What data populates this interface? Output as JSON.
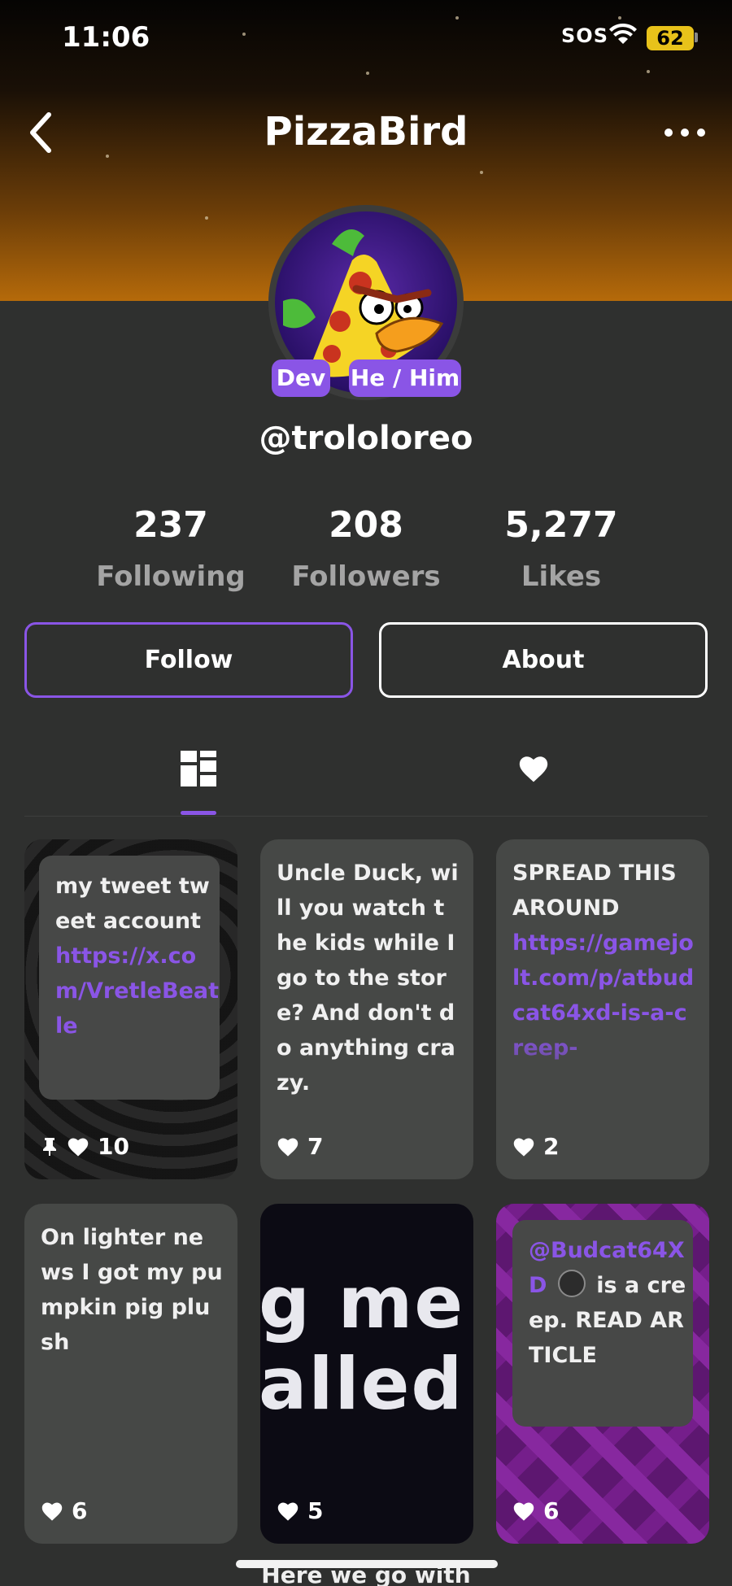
{
  "status_bar": {
    "time": "11:06",
    "sos": "SOS",
    "battery": "62"
  },
  "header": {
    "title": "PizzaBird"
  },
  "profile": {
    "tags": [
      "Dev",
      "He / Him"
    ],
    "username": "@trololoreo",
    "stats": [
      {
        "value": "237",
        "label": "Following"
      },
      {
        "value": "208",
        "label": "Followers"
      },
      {
        "value": "5,277",
        "label": "Likes"
      }
    ]
  },
  "actions": {
    "follow": "Follow",
    "about": "About"
  },
  "tabs": {
    "posts_icon": "grid-icon",
    "likes_icon": "heart-icon",
    "active": "posts"
  },
  "posts": [
    {
      "text": "my tweet tweet account",
      "link": "https://x.com/VretleBeatle",
      "pinned": true,
      "likes": "10"
    },
    {
      "text": "Uncle Duck, will you watch the kids while I go to the store? And don't do anything crazy.",
      "likes": "7"
    },
    {
      "text": "SPREAD THIS AROUND",
      "link": "https://gamejolt.com/p/atbudcat64xd-is-a-creep-",
      "likes": "2"
    },
    {
      "text": "On lighter news I got my pumpkin pig plush",
      "likes": "6"
    },
    {
      "image_line1": "g me o",
      "image_line2": "alled y",
      "likes": "5"
    },
    {
      "mention": "@Budcat64XD",
      "text": "is a creep. READ ARTICLE",
      "likes": "6"
    }
  ],
  "bottom": {
    "peek_text": "Here we go with"
  }
}
